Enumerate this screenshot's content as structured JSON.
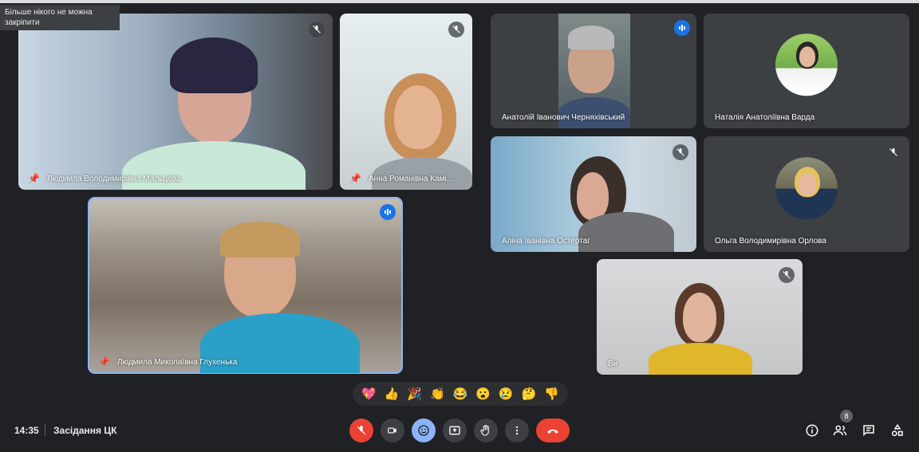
{
  "tooltip": "Більше нікого не можна закріпити",
  "participants": [
    {
      "name": "Людмила Володимирівна Мальцева"
    },
    {
      "name": "Анна Романівна Камі..."
    },
    {
      "name": "Анатолій Іванович Черняхівський"
    },
    {
      "name": "Наталія Анатоліївна Варда"
    },
    {
      "name": "Аліна Іванівна Остертаг"
    },
    {
      "name": "Ольга Володимирівна Орлова"
    },
    {
      "name": "Людмила Миколаївна Глухенька"
    },
    {
      "name": "Ви"
    }
  ],
  "reactions": [
    "💖",
    "👍",
    "🎉",
    "👏",
    "😂",
    "😮",
    "😢",
    "🤔",
    "👎"
  ],
  "bottom": {
    "time": "14:35",
    "meeting_title": "Засідання ЦК",
    "participants_count": "8"
  },
  "colors": {
    "background": "#202124",
    "tile_dark": "#3c4043",
    "accent_blue": "#8ab4f8",
    "speaking_blue": "#1a73e8",
    "danger_red": "#ea4335"
  },
  "icons": {
    "mic_muted": "mic-off-icon",
    "speaking": "audio-level-icon",
    "pin": "pin-icon",
    "camera": "camera-icon",
    "emoji": "emoji-icon",
    "present": "present-screen-icon",
    "hand": "raise-hand-icon",
    "more": "more-vert-icon",
    "leave": "call-end-icon",
    "info": "info-icon",
    "people": "people-icon",
    "chat": "chat-icon",
    "activities": "activities-icon"
  }
}
